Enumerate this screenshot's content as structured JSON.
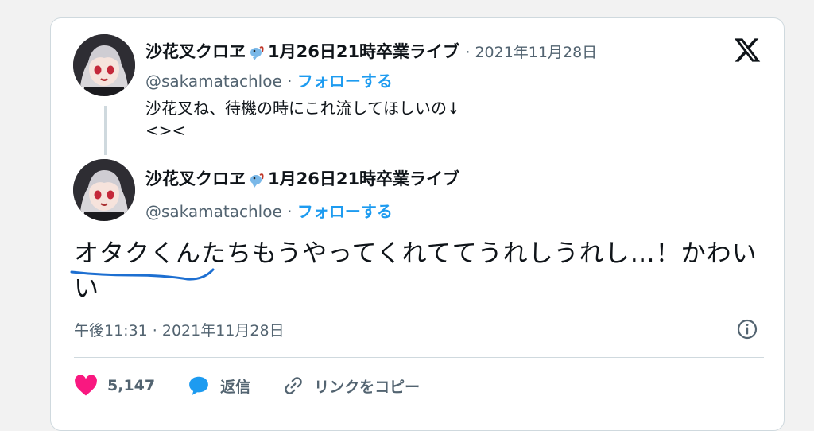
{
  "tweet_parent": {
    "display_name": "沙花叉クロヱ",
    "name_suffix": "1月26日21時卒業ライブ",
    "date": "· 2021年11月28日",
    "handle": "@sakamatachloe ·",
    "follow_label": "フォローする",
    "text_line1": "沙花叉ね、待機の時にこれ流してほしいの↓",
    "text_line2": "<><"
  },
  "tweet_main": {
    "display_name": "沙花叉クロヱ",
    "name_suffix": "1月26日21時卒業ライブ",
    "handle": "@sakamatachloe ·",
    "follow_label": "フォローする",
    "text_highlight": "オタクくん",
    "text_rest": "たちもうやってくれててうれしうれし…！かわいい",
    "timestamp": "午後11:31 · 2021年11月28日"
  },
  "actions": {
    "likes": "5,147",
    "reply": "返信",
    "copy_link": "リンクをコピー"
  },
  "icons": [
    "x-logo-icon",
    "info-icon",
    "heart-icon",
    "reply-bubble-icon",
    "link-icon",
    "orca-emoji-icon"
  ],
  "colors": {
    "follow": "#1d9bf0",
    "like": "#f91880",
    "secondary": "#536471",
    "underline": "#1d6fd1"
  }
}
